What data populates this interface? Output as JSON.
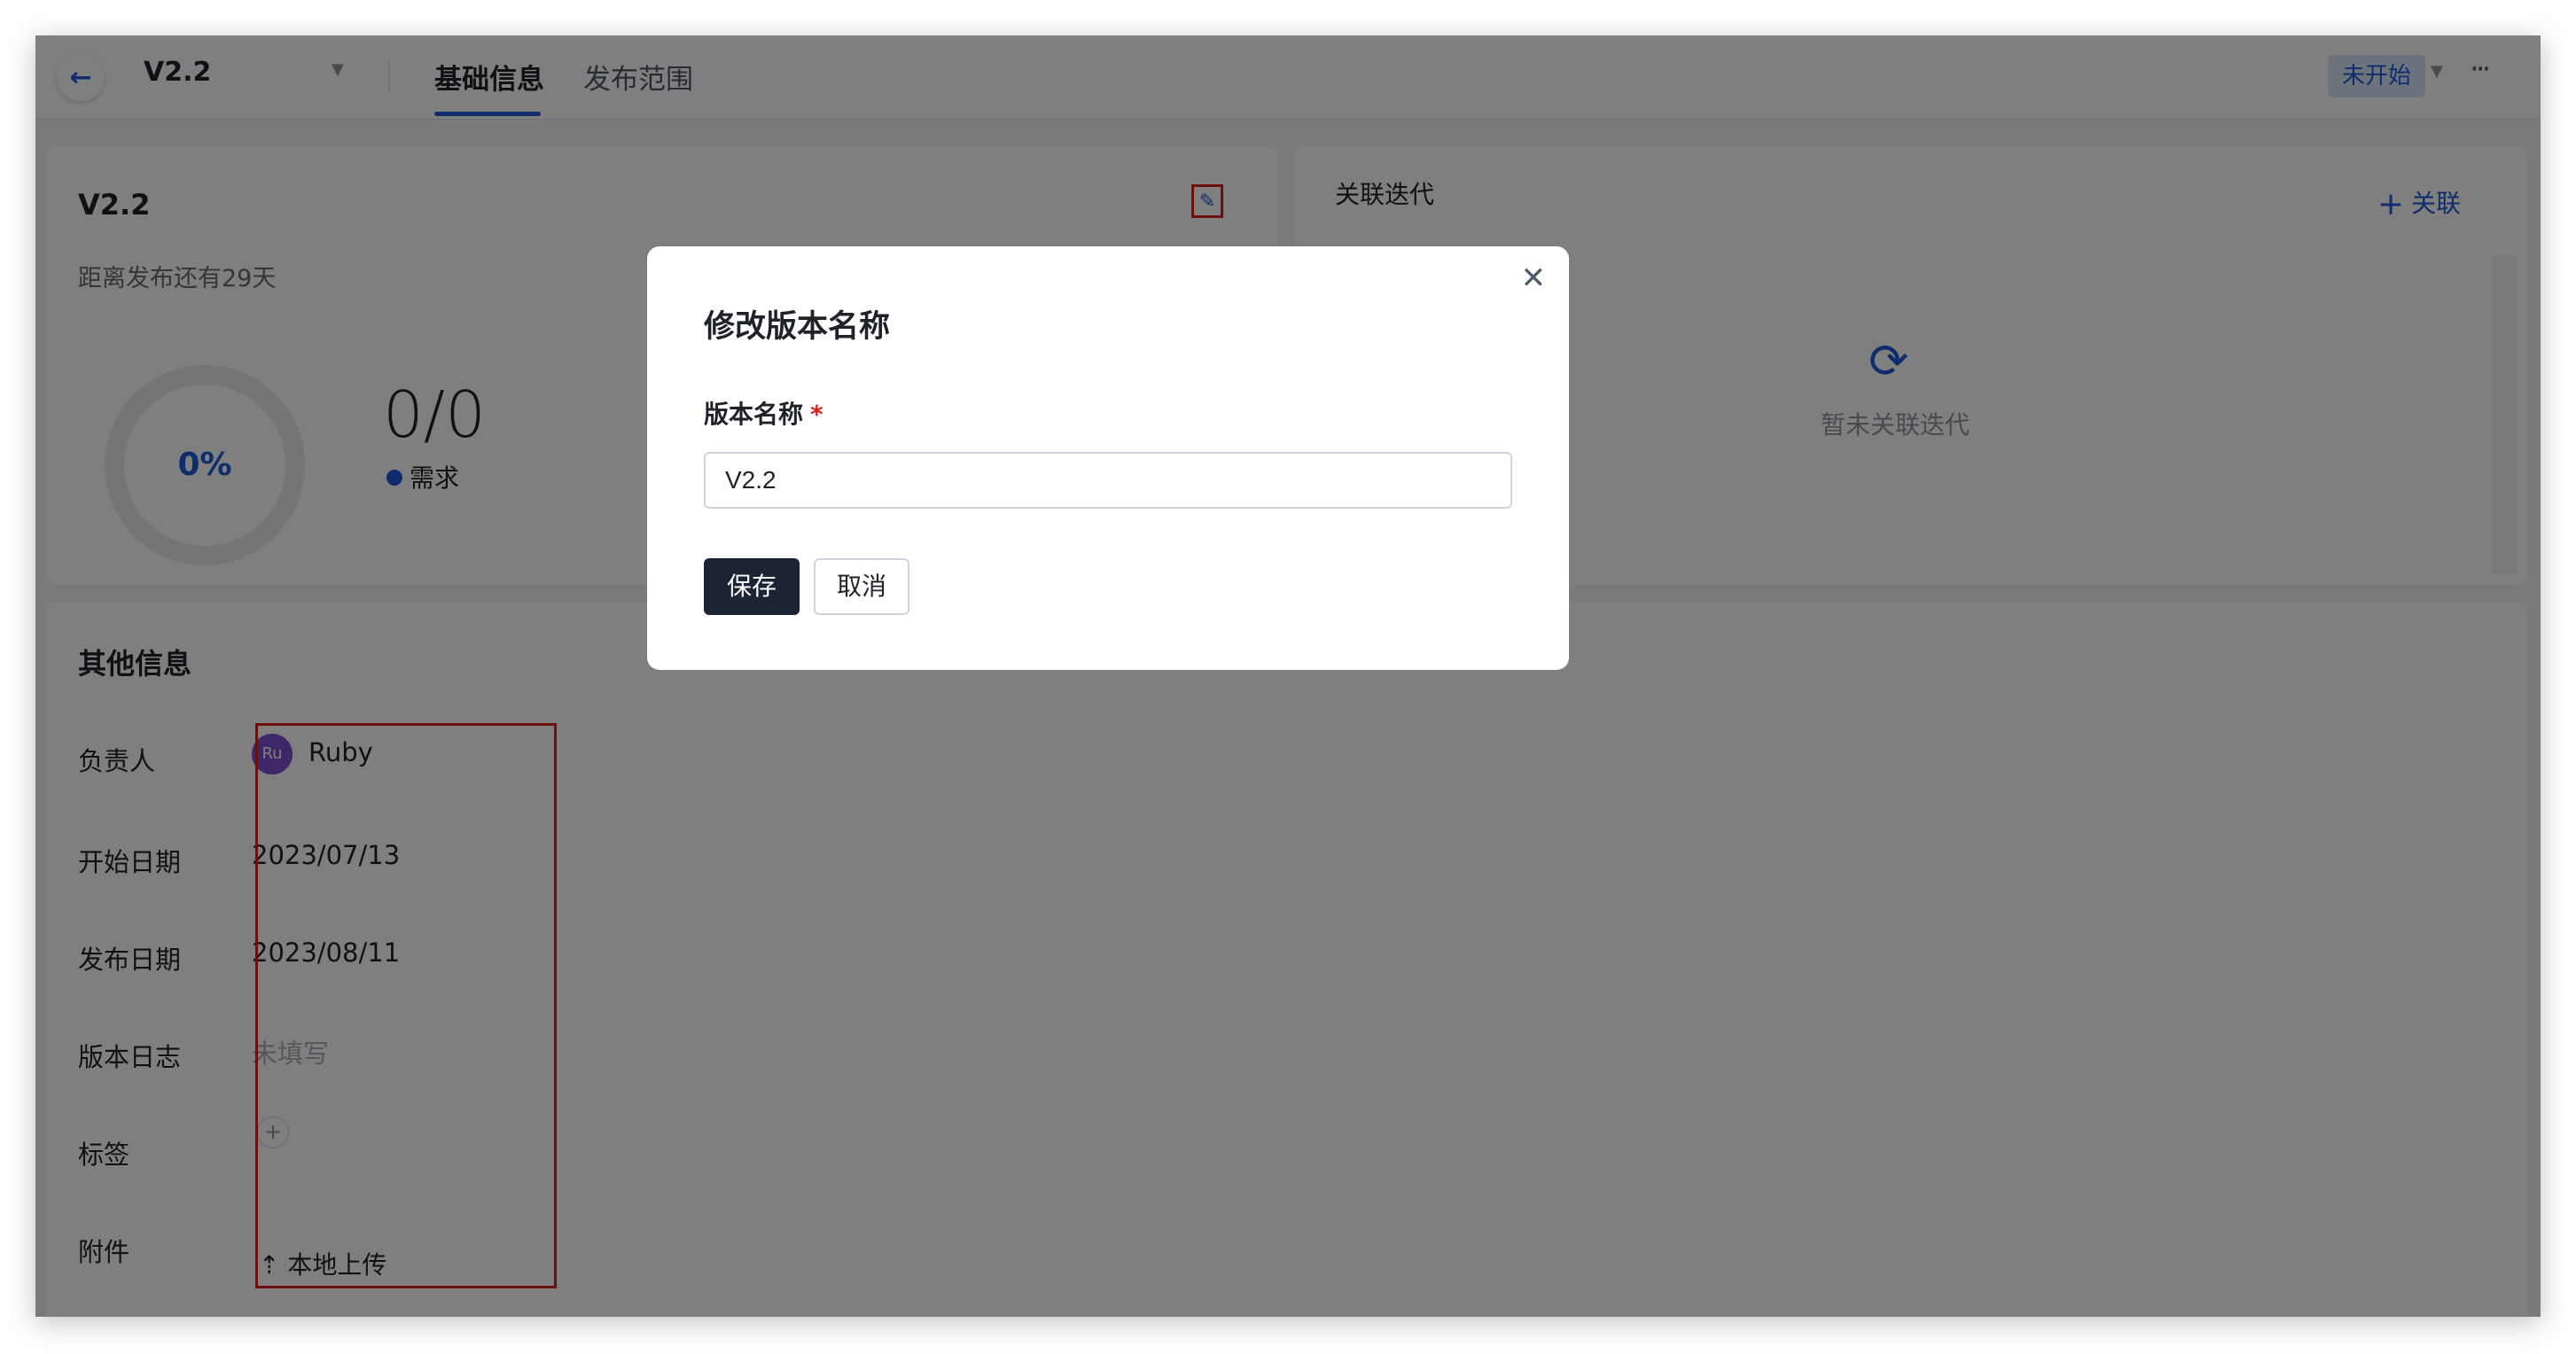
{
  "header": {
    "version_name": "V2.2",
    "tabs": [
      {
        "label": "基础信息",
        "active": true
      },
      {
        "label": "发布范围",
        "active": false
      }
    ],
    "status": "未开始",
    "more_glyph": "···"
  },
  "version_card": {
    "title": "V2.2",
    "countdown": "距离发布还有29天",
    "progress_percent": 0,
    "progress_text": "0%",
    "ratio": "0/0",
    "legend_label": "需求"
  },
  "iteration_card": {
    "title": "关联迭代",
    "link_label": "关联",
    "empty_text": "暂未关联迭代"
  },
  "other_info": {
    "title": "其他信息",
    "owner_label": "负责人",
    "owner_initials": "Ru",
    "owner_name": "Ruby",
    "start_label": "开始日期",
    "start_value": "2023/07/13",
    "release_label": "发布日期",
    "release_value": "2023/08/11",
    "log_label": "版本日志",
    "log_value": "未填写",
    "tags_label": "标签",
    "attach_label": "附件",
    "upload_label": "本地上传"
  },
  "modal": {
    "title": "修改版本名称",
    "field_label": "版本名称",
    "required_mark": "*",
    "field_value": "V2.2",
    "save_label": "保存",
    "cancel_label": "取消"
  },
  "colors": {
    "accent": "#1e5bd8",
    "highlight": "#d81e1e",
    "primary_button": "#1c2434"
  }
}
